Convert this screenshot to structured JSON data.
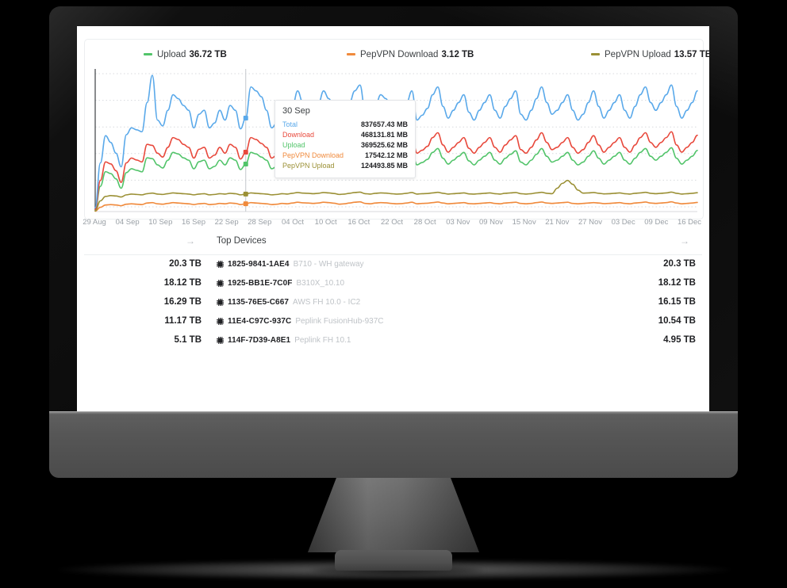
{
  "legend": [
    {
      "name": "Upload",
      "label": "Upload",
      "value": "36.72 TB",
      "color": "#52c46a"
    },
    {
      "name": "PepVPN Download",
      "label": "PepVPN Download",
      "value": "3.12 TB",
      "color": "#f08a3c"
    },
    {
      "name": "PepVPN Upload",
      "label": "PepVPN Upload",
      "value": "13.57 TB",
      "color": "#9b9035"
    }
  ],
  "tooltip": {
    "date": "30 Sep",
    "rows": [
      {
        "label": "Total",
        "value": "837657.43 MB",
        "color": "#5aa9ea"
      },
      {
        "label": "Download",
        "value": "468131.81 MB",
        "color": "#e8493c"
      },
      {
        "label": "Upload",
        "value": "369525.62 MB",
        "color": "#52c46a"
      },
      {
        "label": "PepVPN Download",
        "value": "17542.12 MB",
        "color": "#f08a3c"
      },
      {
        "label": "PepVPN Upload",
        "value": "124493.85 MB",
        "color": "#9b9035"
      }
    ]
  },
  "top_devices": {
    "title": "Top Devices",
    "arrow_left": "→",
    "arrow_right": "→",
    "rows": [
      {
        "left": "20.3 TB",
        "id": "1825-9841-1AE4",
        "desc": "B710 - WH gateway",
        "right": "20.3 TB"
      },
      {
        "left": "18.12 TB",
        "id": "1925-BB1E-7C0F",
        "desc": "B310X_10.10",
        "right": "18.12 TB"
      },
      {
        "left": "16.29 TB",
        "id": "1135-76E5-C667",
        "desc": "AWS FH 10.0 - IC2",
        "right": "16.15 TB"
      },
      {
        "left": "11.17 TB",
        "id": "11E4-C97C-937C",
        "desc": "Peplink FusionHub-937C",
        "right": "10.54 TB"
      },
      {
        "left": "5.1 TB",
        "id": "114F-7D39-A8E1",
        "desc": "Peplink FH 10.1",
        "right": "4.95 TB"
      }
    ]
  },
  "chart_data": {
    "type": "line",
    "title": "",
    "xlabel": "",
    "ylabel": "",
    "grid": true,
    "legend_position": "top",
    "ylim": [
      0,
      1000000
    ],
    "yunit": "MB",
    "highlight_x": "30 Sep",
    "xticks": [
      "29 Aug",
      "04 Sep",
      "10 Sep",
      "16 Sep",
      "22 Sep",
      "28 Sep",
      "04 Oct",
      "10 Oct",
      "16 Oct",
      "22 Oct",
      "28 Oct",
      "03 Nov",
      "09 Nov",
      "15 Nov",
      "21 Nov",
      "27 Nov",
      "03 Dec",
      "09 Dec",
      "16 Dec"
    ],
    "series": [
      {
        "name": "Total",
        "color": "#5aa9ea",
        "total": "",
        "values": [
          20,
          250,
          390,
          355,
          300,
          230,
          395,
          430,
          420,
          410,
          560,
          700,
          470,
          440,
          520,
          600,
          580,
          545,
          520,
          430,
          500,
          520,
          430,
          455,
          520,
          470,
          545,
          520,
          425,
          480,
          640,
          620,
          590,
          520,
          430,
          455,
          520,
          470,
          540,
          620,
          560,
          545,
          520,
          555,
          620,
          580,
          530,
          455,
          500,
          560,
          620,
          650,
          520,
          480,
          545,
          600,
          580,
          520,
          480,
          500,
          560,
          620,
          470,
          495,
          530,
          600,
          640,
          540,
          480,
          520,
          560,
          600,
          510,
          470,
          520,
          560,
          600,
          520,
          480,
          540,
          580,
          620,
          500,
          470,
          520,
          580,
          640,
          560,
          500,
          520,
          560,
          600,
          520,
          470,
          500,
          560,
          620,
          540,
          480,
          520,
          560,
          600,
          520,
          480,
          540,
          600,
          640,
          560,
          520,
          560,
          600,
          650,
          540,
          480,
          520,
          560,
          620
        ]
      },
      {
        "name": "Download",
        "color": "#e8493c",
        "total": "",
        "values": [
          10,
          160,
          255,
          245,
          210,
          150,
          250,
          275,
          265,
          255,
          345,
          340,
          300,
          280,
          330,
          380,
          370,
          345,
          330,
          275,
          320,
          330,
          275,
          290,
          330,
          300,
          345,
          330,
          270,
          305,
          380,
          370,
          350,
          330,
          275,
          290,
          330,
          300,
          340,
          390,
          355,
          345,
          330,
          352,
          390,
          370,
          335,
          290,
          320,
          355,
          390,
          410,
          330,
          305,
          345,
          380,
          370,
          330,
          305,
          320,
          355,
          390,
          300,
          315,
          335,
          380,
          405,
          342,
          305,
          330,
          355,
          380,
          325,
          300,
          330,
          355,
          380,
          330,
          305,
          342,
          368,
          390,
          318,
          300,
          330,
          368,
          405,
          355,
          318,
          330,
          355,
          380,
          330,
          300,
          318,
          355,
          390,
          342,
          305,
          330,
          355,
          380,
          330,
          305,
          342,
          380,
          405,
          355,
          330,
          355,
          380,
          410,
          342,
          305,
          330,
          355,
          392
        ]
      },
      {
        "name": "Upload",
        "color": "#52c46a",
        "total": "36.72 TB",
        "values": [
          8,
          130,
          205,
          195,
          168,
          120,
          200,
          220,
          212,
          204,
          276,
          272,
          240,
          224,
          264,
          304,
          296,
          276,
          264,
          220,
          256,
          264,
          220,
          232,
          264,
          240,
          276,
          264,
          216,
          244,
          304,
          296,
          280,
          264,
          220,
          232,
          264,
          240,
          272,
          312,
          284,
          276,
          264,
          282,
          312,
          296,
          268,
          232,
          256,
          284,
          312,
          328,
          264,
          244,
          276,
          304,
          296,
          264,
          244,
          256,
          284,
          312,
          240,
          252,
          268,
          304,
          324,
          274,
          244,
          264,
          284,
          304,
          260,
          240,
          264,
          284,
          304,
          264,
          244,
          274,
          294,
          312,
          254,
          240,
          264,
          294,
          324,
          284,
          254,
          264,
          284,
          304,
          264,
          240,
          254,
          284,
          312,
          274,
          244,
          264,
          284,
          304,
          264,
          244,
          274,
          304,
          324,
          284,
          264,
          284,
          304,
          328,
          274,
          244,
          264,
          284,
          314
        ]
      },
      {
        "name": "PepVPN Upload",
        "color": "#9b9035",
        "total": "13.57 TB",
        "values": [
          4,
          55,
          78,
          82,
          80,
          75,
          86,
          90,
          88,
          86,
          92,
          95,
          90,
          88,
          92,
          96,
          94,
          92,
          90,
          86,
          90,
          92,
          86,
          88,
          92,
          90,
          94,
          92,
          86,
          90,
          96,
          94,
          92,
          90,
          86,
          88,
          92,
          90,
          94,
          98,
          95,
          94,
          92,
          94,
          98,
          96,
          93,
          88,
          90,
          94,
          98,
          100,
          92,
          90,
          94,
          96,
          95,
          92,
          90,
          91,
          94,
          98,
          90,
          92,
          93,
          96,
          99,
          94,
          90,
          92,
          94,
          96,
          91,
          90,
          92,
          94,
          96,
          92,
          90,
          94,
          96,
          98,
          92,
          90,
          92,
          96,
          99,
          94,
          92,
          120,
          145,
          160,
          140,
          110,
          95,
          96,
          98,
          94,
          91,
          92,
          94,
          96,
          92,
          90,
          94,
          96,
          99,
          94,
          92,
          94,
          96,
          100,
          94,
          90,
          92,
          94,
          97
        ]
      },
      {
        "name": "PepVPN Download",
        "color": "#f08a3c",
        "total": "3.12 TB",
        "values": [
          2,
          22,
          34,
          36,
          34,
          30,
          38,
          40,
          38,
          36,
          44,
          46,
          40,
          38,
          42,
          46,
          44,
          42,
          40,
          36,
          40,
          42,
          36,
          38,
          42,
          40,
          44,
          42,
          36,
          40,
          46,
          44,
          42,
          40,
          36,
          38,
          42,
          40,
          44,
          48,
          45,
          44,
          42,
          44,
          48,
          46,
          43,
          38,
          40,
          44,
          48,
          50,
          42,
          40,
          44,
          46,
          45,
          42,
          40,
          41,
          44,
          48,
          40,
          42,
          43,
          46,
          49,
          44,
          40,
          42,
          44,
          46,
          41,
          40,
          42,
          44,
          46,
          42,
          40,
          44,
          46,
          48,
          42,
          40,
          42,
          46,
          49,
          44,
          42,
          44,
          46,
          48,
          42,
          40,
          42,
          44,
          46,
          44,
          41,
          42,
          44,
          46,
          42,
          40,
          44,
          46,
          49,
          44,
          42,
          44,
          46,
          50,
          44,
          40,
          42,
          44,
          47
        ]
      }
    ]
  }
}
